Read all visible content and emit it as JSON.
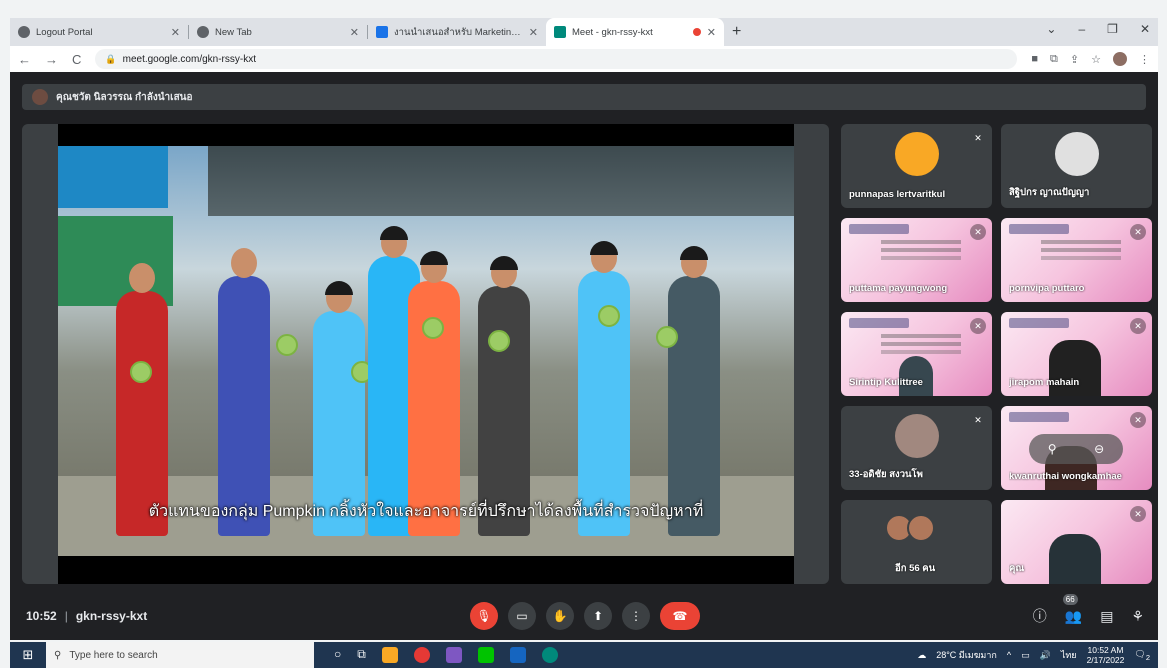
{
  "browser": {
    "tabs": [
      {
        "title": "Logout Portal",
        "active": false
      },
      {
        "title": "New Tab",
        "active": false
      },
      {
        "title": "งานนำเสนอสำหรับ Marketing Stra",
        "active": false
      },
      {
        "title": "Meet - gkn-rssy-kxt",
        "active": true
      }
    ],
    "new_tab": "+",
    "url": "meet.google.com/gkn-rssy-kxt"
  },
  "meet": {
    "presenter_notice": "คุณชวัต นิลวรรณ กำลังนำเสนอ",
    "subtitle": "ตัวแทนของกลุ่ม Pumpkin กลิ้งหัวใจและอาจารย์ที่ปรึกษาได้ลงพื้นที่สำรวจปัญหาที่",
    "participants": [
      {
        "name": "punnapas lertvaritkul",
        "style": "dark",
        "muted": true
      },
      {
        "name": "สิฐิปกร ญาณปัญญา",
        "style": "dark",
        "muted": false
      },
      {
        "name": "puttama payungwong",
        "style": "pink",
        "muted": true
      },
      {
        "name": "pornvipa puttaro",
        "style": "pink",
        "muted": true
      },
      {
        "name": "Sirintip Kulittree",
        "style": "pink",
        "muted": true
      },
      {
        "name": "jirapom mahain",
        "style": "pink",
        "muted": true
      },
      {
        "name": "33-อดิชัย สงวนโพ",
        "style": "dark",
        "muted": true
      },
      {
        "name": "kwanruthai wongkamhae",
        "style": "pink",
        "muted": true
      }
    ],
    "others": "อีก 56 คน",
    "self_label": "คุณ",
    "time": "10:52",
    "meeting_code": "gkn-rssy-kxt",
    "participant_count": "66"
  },
  "taskbar": {
    "search_placeholder": "Type here to search",
    "weather": "28°C มีเมฆมาก",
    "lang": "ไทย",
    "clock_time": "10:52 AM",
    "clock_date": "2/17/2022",
    "notif_count": "2"
  },
  "colors": {
    "meet_bg": "#202124",
    "tile_bg": "#3c4043",
    "end_call": "#ea4335"
  }
}
